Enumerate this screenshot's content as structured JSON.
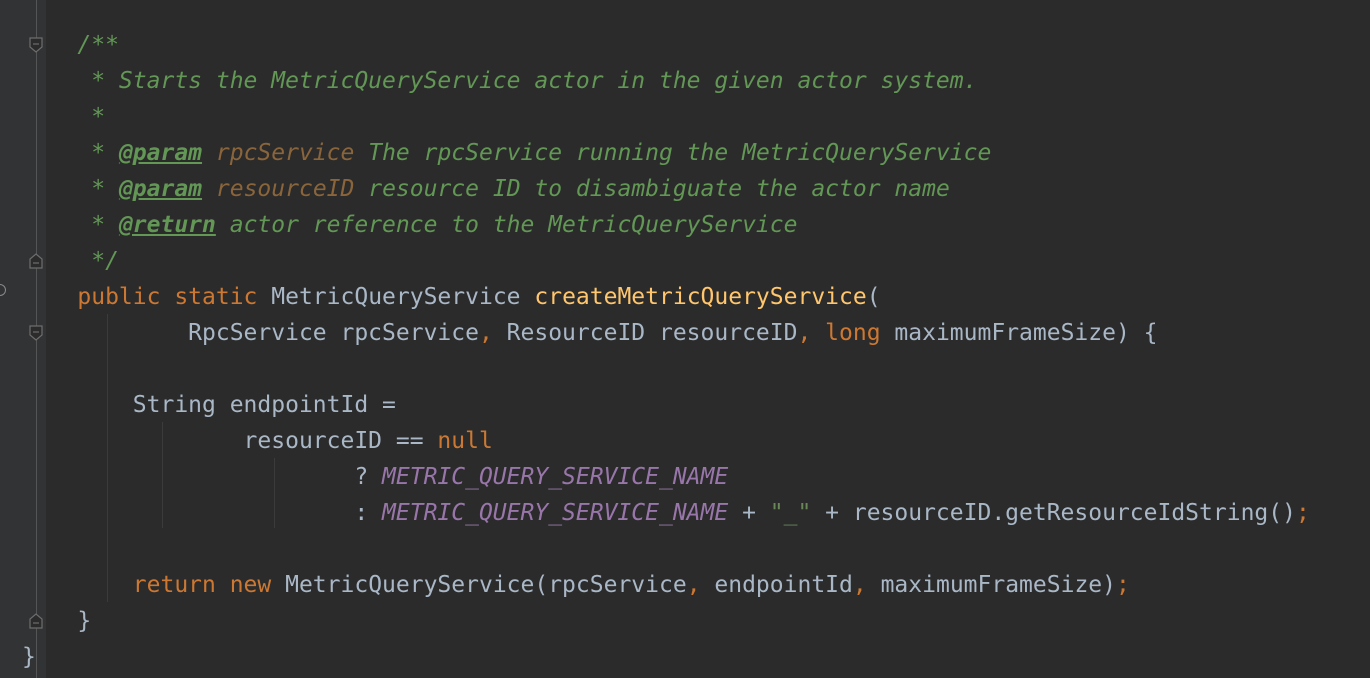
{
  "editor": {
    "lines": [
      [
        {
          "t": "    /**",
          "s": "doc"
        }
      ],
      [
        {
          "t": "     * Starts the MetricQueryService actor in the given actor system.",
          "s": "doc"
        }
      ],
      [
        {
          "t": "     *",
          "s": "doc"
        }
      ],
      [
        {
          "t": "     * ",
          "s": "doc"
        },
        {
          "t": "@param",
          "s": "tag"
        },
        {
          "t": " ",
          "s": "doc"
        },
        {
          "t": "rpcService",
          "s": "pname"
        },
        {
          "t": " The rpcService running the MetricQueryService",
          "s": "doc"
        }
      ],
      [
        {
          "t": "     * ",
          "s": "doc"
        },
        {
          "t": "@param",
          "s": "tag"
        },
        {
          "t": " ",
          "s": "doc"
        },
        {
          "t": "resourceID",
          "s": "pname"
        },
        {
          "t": " resource ID to disambiguate the actor name",
          "s": "doc"
        }
      ],
      [
        {
          "t": "     * ",
          "s": "doc"
        },
        {
          "t": "@return",
          "s": "tag"
        },
        {
          "t": " actor reference to the MetricQueryService",
          "s": "doc"
        }
      ],
      [
        {
          "t": "     */",
          "s": "doc"
        }
      ],
      [
        {
          "t": "    ",
          "s": "plain"
        },
        {
          "t": "public static ",
          "s": "kw"
        },
        {
          "t": "MetricQueryService ",
          "s": "plain"
        },
        {
          "t": "createMetricQueryService",
          "s": "fn"
        },
        {
          "t": "(",
          "s": "plain"
        }
      ],
      [
        {
          "t": "            RpcService rpcService",
          "s": "plain"
        },
        {
          "t": ", ",
          "s": "kw"
        },
        {
          "t": "ResourceID resourceID",
          "s": "plain"
        },
        {
          "t": ", ",
          "s": "kw"
        },
        {
          "t": "long ",
          "s": "kw"
        },
        {
          "t": "maximumFrameSize) {",
          "s": "plain"
        }
      ],
      [
        {
          "t": "",
          "s": "plain"
        }
      ],
      [
        {
          "t": "        String endpointId =",
          "s": "plain"
        }
      ],
      [
        {
          "t": "                resourceID == ",
          "s": "plain"
        },
        {
          "t": "null",
          "s": "kw"
        }
      ],
      [
        {
          "t": "                        ? ",
          "s": "plain"
        },
        {
          "t": "METRIC_QUERY_SERVICE_NAME",
          "s": "const"
        }
      ],
      [
        {
          "t": "                        : ",
          "s": "plain"
        },
        {
          "t": "METRIC_QUERY_SERVICE_NAME",
          "s": "const"
        },
        {
          "t": " + ",
          "s": "plain"
        },
        {
          "t": "\"_\"",
          "s": "str"
        },
        {
          "t": " + resourceID.getResourceIdString()",
          "s": "plain"
        },
        {
          "t": ";",
          "s": "kw"
        }
      ],
      [
        {
          "t": "",
          "s": "plain"
        }
      ],
      [
        {
          "t": "        ",
          "s": "plain"
        },
        {
          "t": "return new ",
          "s": "kw"
        },
        {
          "t": "MetricQueryService(rpcService",
          "s": "plain"
        },
        {
          "t": ", ",
          "s": "kw"
        },
        {
          "t": "endpointId",
          "s": "plain"
        },
        {
          "t": ", ",
          "s": "kw"
        },
        {
          "t": "maximumFrameSize)",
          "s": "plain"
        },
        {
          "t": ";",
          "s": "kw"
        }
      ],
      [
        {
          "t": "    }",
          "s": "plain"
        }
      ],
      [
        {
          "t": "}",
          "s": "plain"
        }
      ]
    ]
  }
}
